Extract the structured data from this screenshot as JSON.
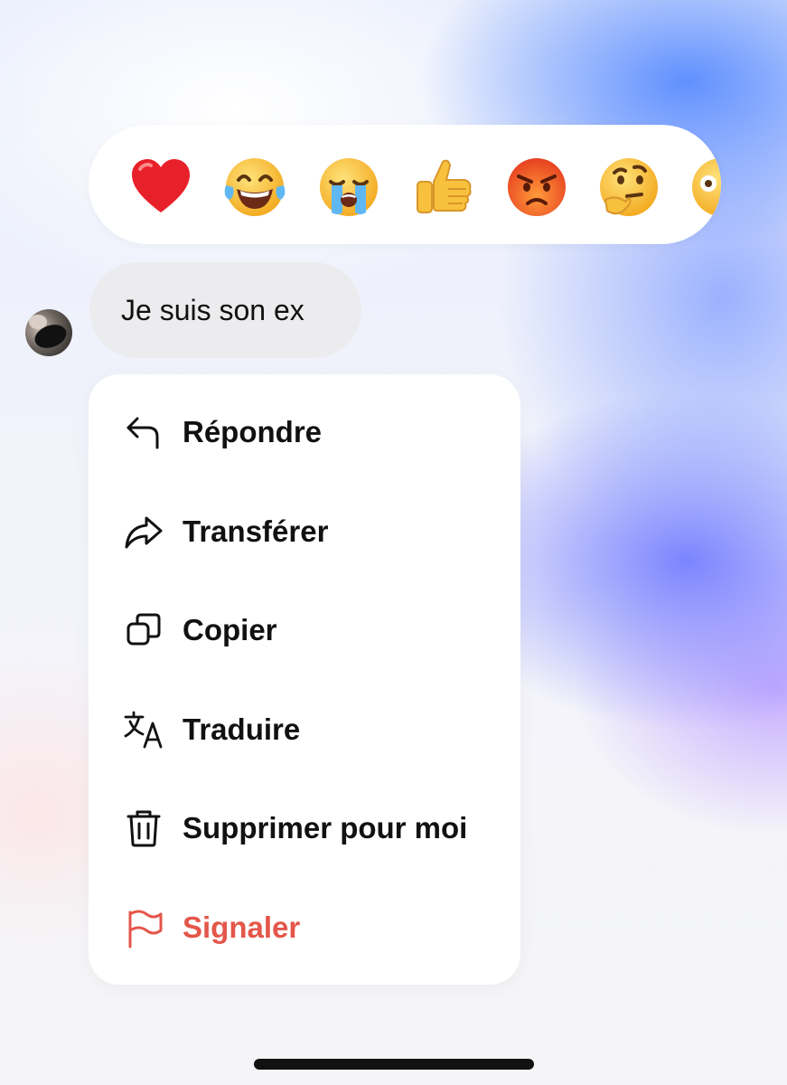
{
  "reactions": [
    {
      "name": "red-heart",
      "glyph": "❤️"
    },
    {
      "name": "tears-of-joy",
      "glyph": "😂"
    },
    {
      "name": "loudly-crying",
      "glyph": "😭"
    },
    {
      "name": "thumbs-up",
      "glyph": "👍"
    },
    {
      "name": "angry",
      "glyph": "😡"
    },
    {
      "name": "thinking",
      "glyph": "🤔"
    },
    {
      "name": "astonished",
      "glyph": "😳"
    }
  ],
  "message": {
    "text": "Je suis son ex"
  },
  "menu": {
    "items": [
      {
        "label": "Répondre",
        "icon": "reply-icon"
      },
      {
        "label": "Transférer",
        "icon": "forward-icon"
      },
      {
        "label": "Copier",
        "icon": "copy-icon"
      },
      {
        "label": "Traduire",
        "icon": "translate-icon"
      },
      {
        "label": "Supprimer pour moi",
        "icon": "trash-icon"
      },
      {
        "label": "Signaler",
        "icon": "flag-icon"
      }
    ]
  },
  "colors": {
    "danger": "#e4564a",
    "bubble": "#ececee",
    "text": "#111111"
  }
}
